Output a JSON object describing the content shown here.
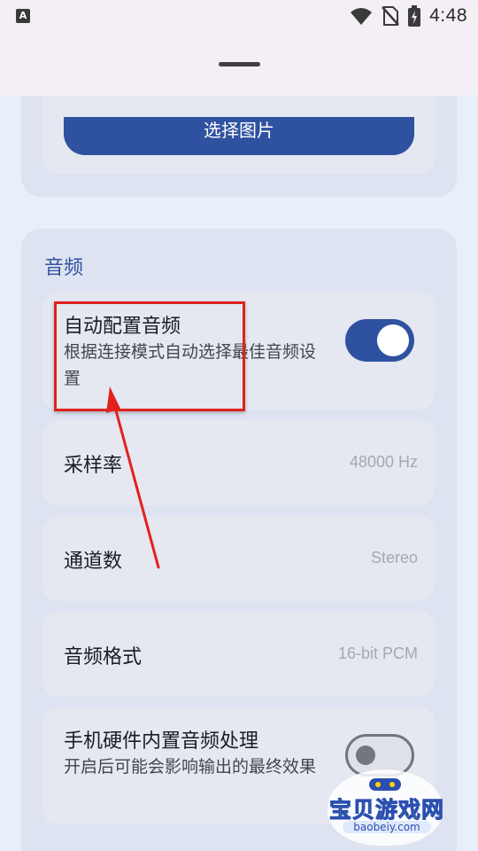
{
  "status_bar": {
    "app_icon_letter": "A",
    "time": "4:48",
    "icons": [
      "wifi-icon",
      "no-sim-icon",
      "battery-charging-icon"
    ]
  },
  "previous_card": {
    "button_label": "选择图片"
  },
  "audio": {
    "section_title": "音频",
    "auto_config": {
      "title": "自动配置音频",
      "description": "根据连接模式自动选择最佳音频设置",
      "enabled": true
    },
    "sample_rate": {
      "title": "采样率",
      "value": "48000 Hz"
    },
    "channels": {
      "title": "通道数",
      "value": "Stereo"
    },
    "format": {
      "title": "音频格式",
      "value": "16-bit PCM"
    },
    "hardware_processing": {
      "title": "手机硬件内置音频处理",
      "description": "开启后可能会影响输出的最终效果",
      "enabled": false
    }
  },
  "annotation": {
    "highlight_color": "#e0211d",
    "arrow_color": "#e0211d"
  },
  "watermark": {
    "title": "宝贝游戏网",
    "url": "baobeiy.com"
  }
}
